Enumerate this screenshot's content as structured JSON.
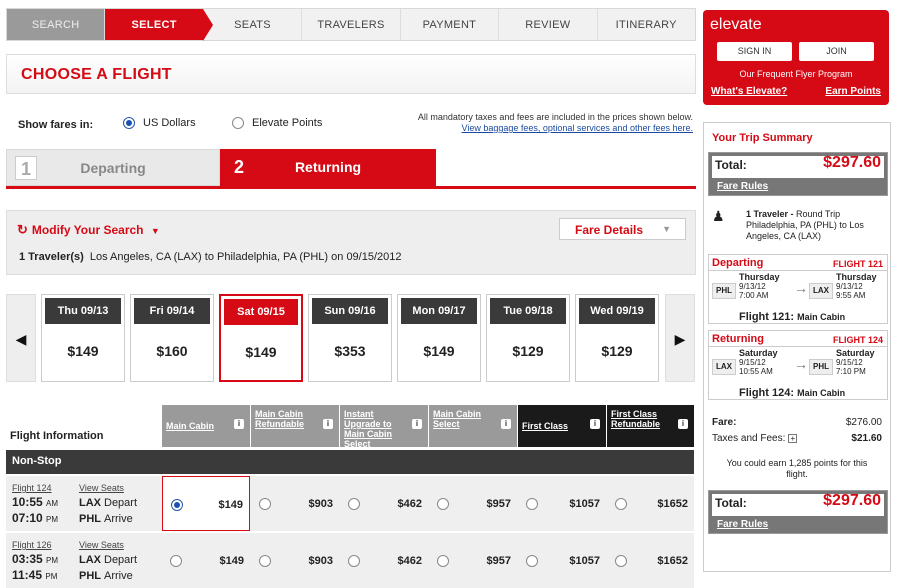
{
  "steps": [
    {
      "label": "SEARCH",
      "state": "done"
    },
    {
      "label": "SELECT",
      "state": "active"
    },
    {
      "label": "SEATS",
      "state": "todo"
    },
    {
      "label": "TRAVELERS",
      "state": "todo"
    },
    {
      "label": "PAYMENT",
      "state": "todo"
    },
    {
      "label": "REVIEW",
      "state": "todo"
    },
    {
      "label": "ITINERARY",
      "state": "todo"
    }
  ],
  "page_title": "CHOOSE A FLIGHT",
  "fares": {
    "label": "Show fares in:",
    "option_usd": "US Dollars",
    "option_points": "Elevate Points",
    "selected": "usd",
    "tax_note": "All mandatory taxes and fees are included in the prices shown below.",
    "tax_link": "View baggage fees, optional services and other fees here."
  },
  "tabs": {
    "departing_num": "1",
    "departing_label": "Departing",
    "returning_num": "2",
    "returning_label": "Returning"
  },
  "modify": {
    "title": "Modify Your Search",
    "fare_details": "Fare Details",
    "travelers": "1 Traveler(s)",
    "route": "Los Angeles, CA (LAX) to Philadelphia, PA (PHL) on 09/15/2012"
  },
  "dates": [
    {
      "day": "Thu 09/13",
      "price": "$149",
      "selected": false
    },
    {
      "day": "Fri 09/14",
      "price": "$160",
      "selected": false
    },
    {
      "day": "Sat 09/15",
      "price": "$149",
      "selected": true
    },
    {
      "day": "Sun 09/16",
      "price": "$353",
      "selected": false
    },
    {
      "day": "Mon 09/17",
      "price": "$149",
      "selected": false
    },
    {
      "day": "Tue 09/18",
      "price": "$129",
      "selected": false
    },
    {
      "day": "Wed 09/19",
      "price": "$129",
      "selected": false
    }
  ],
  "table": {
    "flight_info_label": "Flight Information",
    "columns": [
      {
        "label": "Main Cabin",
        "tone": "grey"
      },
      {
        "label": "Main Cabin Refundable",
        "tone": "grey"
      },
      {
        "label": "Instant Upgrade to Main Cabin Select",
        "tone": "grey"
      },
      {
        "label": "Main Cabin Select",
        "tone": "grey"
      },
      {
        "label": "First Class",
        "tone": "black"
      },
      {
        "label": "First Class Refundable",
        "tone": "black"
      }
    ],
    "group_label": "Non-Stop",
    "view_seats": "View Seats",
    "flights": [
      {
        "number": "Flight 124",
        "dep_time": "10:55",
        "dep_ampm": "AM",
        "dep_airport": "LAX",
        "dep_word": "Depart",
        "arr_time": "07:10",
        "arr_ampm": "PM",
        "arr_airport": "PHL",
        "arr_word": "Arrive",
        "prices": [
          "$149",
          "$903",
          "$462",
          "$957",
          "$1057",
          "$1652"
        ],
        "selected_index": 0
      },
      {
        "number": "Flight 126",
        "dep_time": "03:35",
        "dep_ampm": "PM",
        "dep_airport": "LAX",
        "dep_word": "Depart",
        "arr_time": "11:45",
        "arr_ampm": "PM",
        "arr_airport": "PHL",
        "arr_word": "Arrive",
        "prices": [
          "$149",
          "$903",
          "$462",
          "$957",
          "$1057",
          "$1652"
        ],
        "selected_index": -1
      }
    ]
  },
  "elevate": {
    "logo": "elevate",
    "sign_in": "SIGN IN",
    "join": "JOIN",
    "tagline": "Our Frequent Flyer Program",
    "link_whats": "What's Elevate?",
    "link_earn": "Earn Points"
  },
  "summary": {
    "title": "Your Trip Summary",
    "total_label": "Total:",
    "total_value": "$297.60",
    "fare_rules": "Fare Rules",
    "traveler_bold": "1 Traveler -",
    "traveler_text": "Round Trip Philadelphia, PA (PHL) to Los Angeles, CA (LAX)",
    "departing": {
      "label": "Departing",
      "flight": "FLIGHT 121",
      "from": "PHL",
      "to": "LAX",
      "from_day": "Thursday",
      "from_date": "9/13/12",
      "from_time": "7:00 AM",
      "to_day": "Thursday",
      "to_date": "9/13/12",
      "to_time": "9:55 AM",
      "footer": "Flight 121:",
      "cabin": "Main Cabin"
    },
    "returning": {
      "label": "Returning",
      "flight": "FLIGHT 124",
      "from": "LAX",
      "to": "PHL",
      "from_day": "Saturday",
      "from_date": "9/15/12",
      "from_time": "10:55 AM",
      "to_day": "Saturday",
      "to_date": "9/15/12",
      "to_time": "7:10 PM",
      "footer": "Flight 124:",
      "cabin": "Main Cabin"
    },
    "fare_label": "Fare:",
    "fare_value": "$276.00",
    "taxes_label": "Taxes and Fees:",
    "taxes_value": "$21.60",
    "earn_text": "You could earn 1,285 points for this flight."
  },
  "colors": {
    "brand_red": "#d50a15",
    "dark": "#3a3a3a",
    "grey": "#9a9a9a"
  },
  "icons": [
    "refresh-icon",
    "caret-down-icon",
    "chevron-left-icon",
    "chevron-right-icon",
    "info-icon",
    "traveler-icon",
    "arrow-right-icon"
  ]
}
